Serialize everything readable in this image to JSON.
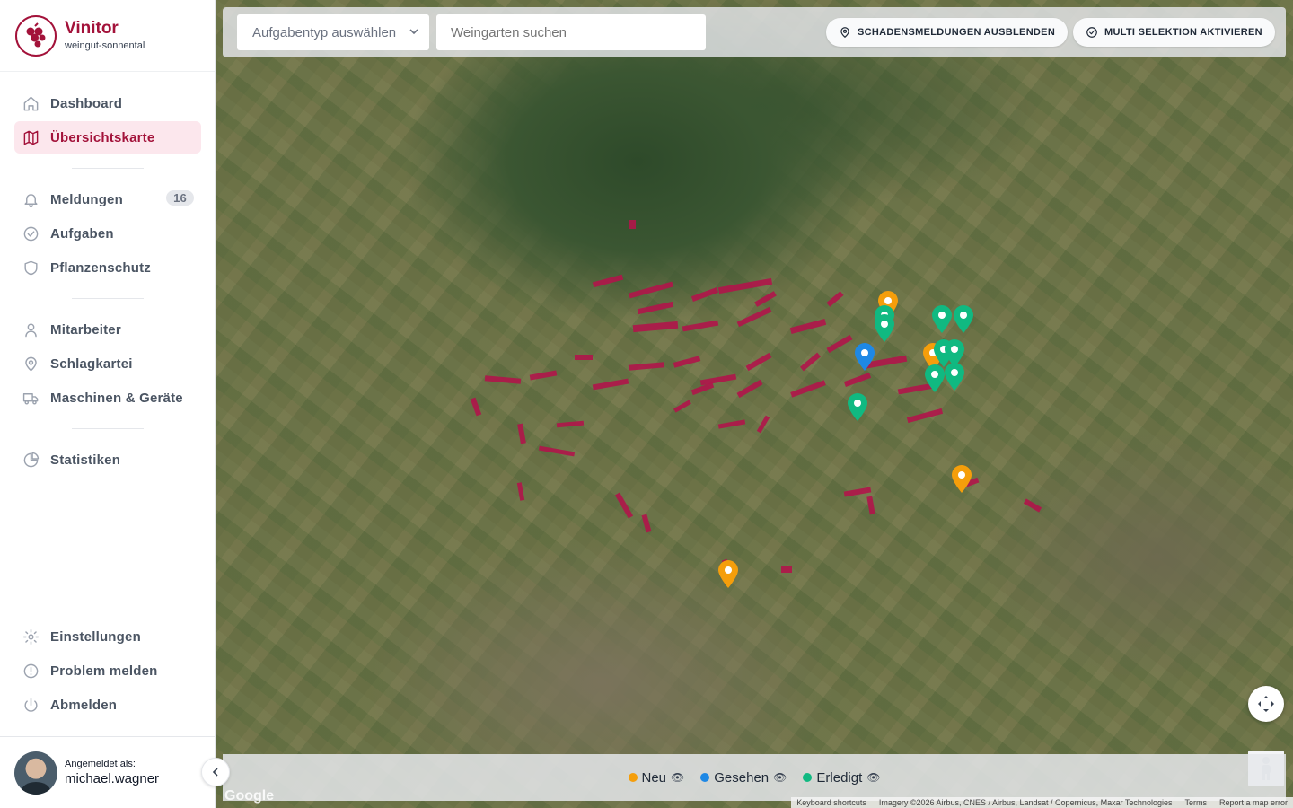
{
  "brand": {
    "name": "Vinitor",
    "subtitle": "weingut-sonnental"
  },
  "nav": {
    "dashboard": "Dashboard",
    "map": "Übersichtskarte",
    "reports": "Meldungen",
    "reports_count": "16",
    "tasks": "Aufgaben",
    "plant_protection": "Pflanzenschutz",
    "staff": "Mitarbeiter",
    "field_index": "Schlagkartei",
    "machines": "Maschinen & Geräte",
    "stats": "Statistiken",
    "settings": "Einstellungen",
    "report_problem": "Problem melden",
    "logout": "Abmelden"
  },
  "user": {
    "label": "Angemeldet als:",
    "name": "michael.wagner"
  },
  "toolbar": {
    "task_type_placeholder": "Aufgabentyp auswählen",
    "vineyard_search_placeholder": "Weingarten suchen",
    "hide_damage_button": "SCHADENSMELDUNGEN AUSBLENDEN",
    "multi_select_button": "MULTI SELEKTION AKTIVIEREN"
  },
  "legend": {
    "new": "Neu",
    "seen": "Gesehen",
    "done": "Erledigt",
    "colors": {
      "new": "#f59e0b",
      "seen": "#1e88e5",
      "done": "#10b981"
    }
  },
  "map": {
    "watermark": "Google",
    "attribution": [
      "Keyboard shortcuts",
      "Imagery ©2026 Airbus, CNES / Airbus, Landsat / Copernicus, Maxar Technologies",
      "Terms",
      "Report a map error"
    ],
    "vineyard_color": "#b0154a"
  },
  "accent_color": "#a3123a"
}
